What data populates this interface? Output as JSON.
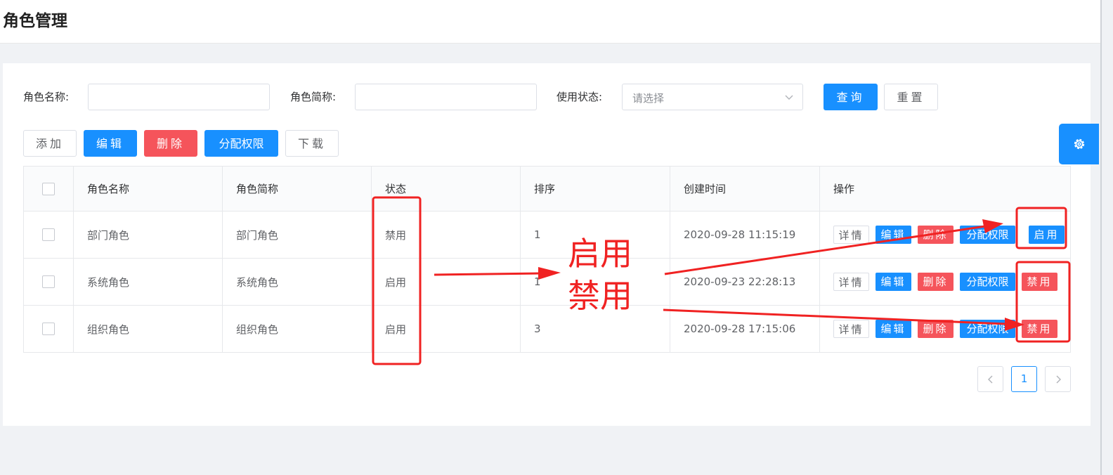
{
  "page": {
    "title": "角色管理"
  },
  "search": {
    "name_label": "角色名称:",
    "name_value": "",
    "short_label": "角色简称:",
    "short_value": "",
    "status_label": "使用状态:",
    "status_placeholder": "请选择",
    "query_label": "查询",
    "reset_label": "重置"
  },
  "toolbar": {
    "add_label": "添加",
    "edit_label": "编辑",
    "delete_label": "删除",
    "assign_label": "分配权限",
    "download_label": "下载"
  },
  "table": {
    "columns": [
      "角色名称",
      "角色简称",
      "状态",
      "排序",
      "创建时间",
      "操作"
    ],
    "rows": [
      {
        "name": "部门角色",
        "short": "部门角色",
        "status": "禁用",
        "sort": "1",
        "created": "2020-09-28 11:15:19",
        "toggle": "启用"
      },
      {
        "name": "系统角色",
        "short": "系统角色",
        "status": "启用",
        "sort": "1",
        "created": "2020-09-23 22:28:13",
        "toggle": "禁用"
      },
      {
        "name": "组织角色",
        "short": "组织角色",
        "status": "启用",
        "sort": "3",
        "created": "2020-09-28 17:15:06",
        "toggle": "禁用"
      }
    ],
    "row_actions": {
      "detail": "详情",
      "edit": "编辑",
      "delete": "删除",
      "assign": "分配权限"
    }
  },
  "pagination": {
    "current": "1",
    "prev_icon": "chevron-left-icon",
    "next_icon": "chevron-right-icon"
  },
  "annotation": {
    "line1": "启用",
    "line2": "禁用"
  },
  "colors": {
    "primary": "#1890ff",
    "danger": "#f5545b",
    "annotation": "#f02222"
  }
}
